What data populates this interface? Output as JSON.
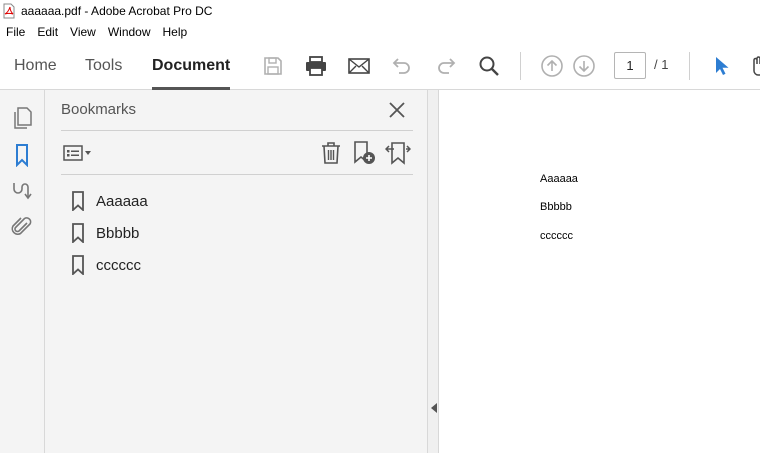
{
  "window": {
    "title": "aaaaaa.pdf - Adobe Acrobat Pro DC"
  },
  "menu": [
    "File",
    "Edit",
    "View",
    "Window",
    "Help"
  ],
  "tabs": [
    {
      "label": "Home",
      "active": false
    },
    {
      "label": "Tools",
      "active": false
    },
    {
      "label": "Document",
      "active": true
    }
  ],
  "toolbar": {
    "icons": [
      "save-icon",
      "print-icon",
      "email-icon",
      "undo-icon",
      "redo-icon",
      "search-icon",
      "page-up-icon",
      "page-down-icon",
      "select-pointer-icon",
      "hand-tool-icon"
    ],
    "page_current": "1",
    "page_total": "/ 1",
    "accent_color": "#2d7dd2"
  },
  "rail": {
    "icons": [
      "page-thumbnails-icon",
      "bookmarks-icon",
      "signatures-icon",
      "attachments-icon"
    ],
    "active": "bookmarks-icon"
  },
  "bookmarks_panel": {
    "title": "Bookmarks",
    "tools": [
      "options-menu-icon",
      "delete-icon",
      "new-bookmark-icon",
      "expand-bookmark-icon"
    ],
    "items": [
      {
        "label": "Aaaaaa"
      },
      {
        "label": "Bbbbb"
      },
      {
        "label": "cccccc"
      }
    ]
  },
  "document": {
    "lines": [
      "Aaaaaa",
      "Bbbbb",
      "cccccc"
    ]
  }
}
